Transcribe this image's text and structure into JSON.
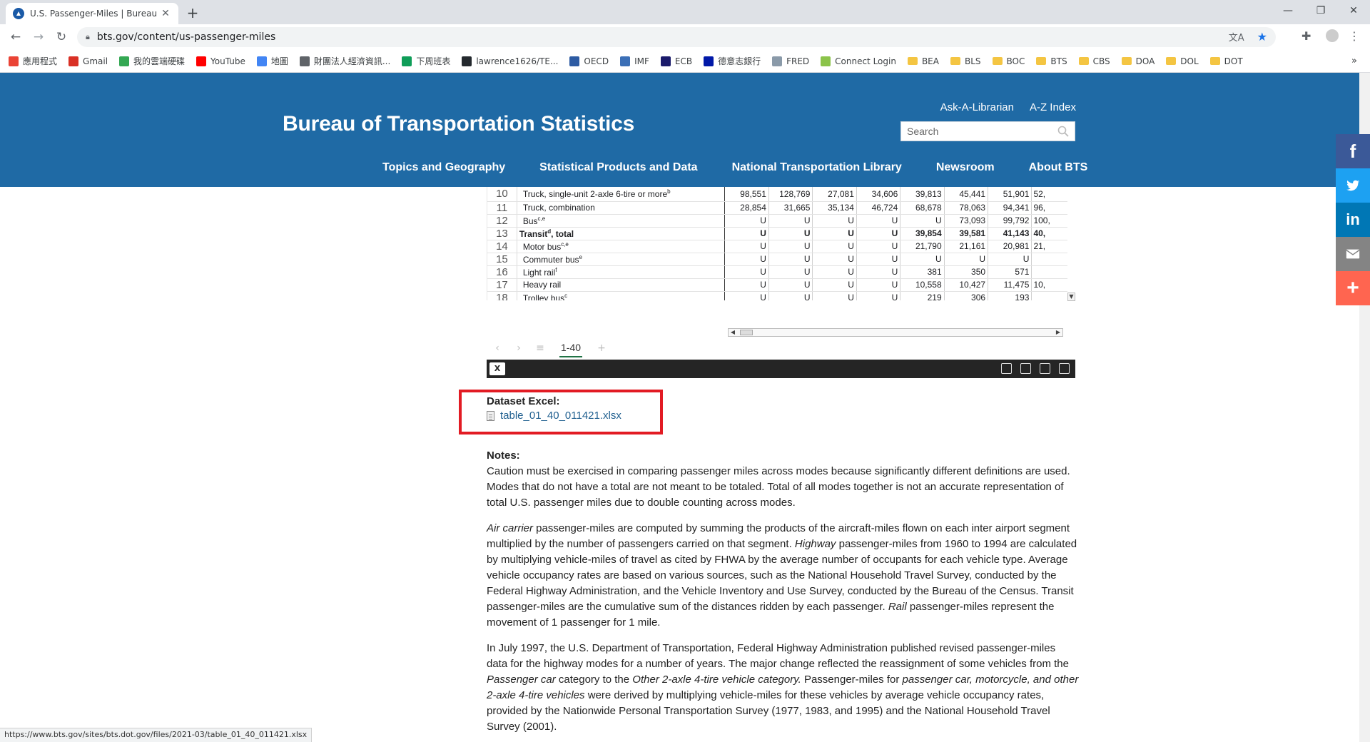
{
  "browser": {
    "tab_title": "U.S. Passenger-Miles | Bureau of",
    "url": "bts.gov/content/us-passenger-miles",
    "status_url": "https://www.bts.gov/sites/bts.dot.gov/files/2021-03/table_01_40_011421.xlsx",
    "bookmarks": [
      {
        "label": "應用程式",
        "icon": "apps-grid-icon",
        "color": "#ea4335",
        "type": "icon"
      },
      {
        "label": "Gmail",
        "icon": "gmail-icon",
        "color": "#d93025",
        "type": "icon"
      },
      {
        "label": "我的雲端硬碟",
        "icon": "drive-icon",
        "color": "#34a853",
        "type": "icon"
      },
      {
        "label": "YouTube",
        "icon": "youtube-icon",
        "color": "#ff0000",
        "type": "icon"
      },
      {
        "label": "地圖",
        "icon": "maps-icon",
        "color": "#4285f4",
        "type": "icon"
      },
      {
        "label": "財團法人經濟資訊...",
        "icon": "globe-icon",
        "color": "#5f6368",
        "type": "icon"
      },
      {
        "label": "下周班表",
        "icon": "sheets-icon",
        "color": "#0f9d58",
        "type": "icon"
      },
      {
        "label": "lawrence1626/TE...",
        "icon": "github-icon",
        "color": "#24292e",
        "type": "icon"
      },
      {
        "label": "OECD",
        "icon": "oecd-icon",
        "color": "#2d5ba3",
        "type": "icon"
      },
      {
        "label": "IMF",
        "icon": "imf-icon",
        "color": "#3b6fb6",
        "type": "icon"
      },
      {
        "label": "ECB",
        "icon": "ecb-icon",
        "color": "#1b1b6b",
        "type": "icon"
      },
      {
        "label": "德意志銀行",
        "icon": "deutsche-bank-icon",
        "color": "#0018a8",
        "type": "icon"
      },
      {
        "label": "FRED",
        "icon": "fred-icon",
        "color": "#8a9aa9",
        "type": "icon"
      },
      {
        "label": "Connect Login",
        "icon": "connect-icon",
        "color": "#8bc34a",
        "type": "icon"
      },
      {
        "label": "BEA",
        "icon": "folder-icon",
        "type": "folder"
      },
      {
        "label": "BLS",
        "icon": "folder-icon",
        "type": "folder"
      },
      {
        "label": "BOC",
        "icon": "folder-icon",
        "type": "folder"
      },
      {
        "label": "BTS",
        "icon": "folder-icon",
        "type": "folder"
      },
      {
        "label": "CBS",
        "icon": "folder-icon",
        "type": "folder"
      },
      {
        "label": "DOA",
        "icon": "folder-icon",
        "type": "folder"
      },
      {
        "label": "DOL",
        "icon": "folder-icon",
        "type": "folder"
      },
      {
        "label": "DOT",
        "icon": "folder-icon",
        "type": "folder"
      }
    ],
    "bookmarks_overflow": "»"
  },
  "site": {
    "title": "Bureau of Transportation Statistics",
    "util_links": [
      "Ask-A-Librarian",
      "A-Z Index"
    ],
    "search_placeholder": "Search",
    "nav": [
      "Topics and Geography",
      "Statistical Products and Data",
      "National Transportation Library",
      "Newsroom",
      "About BTS"
    ],
    "header_color": "#1f6aa5"
  },
  "spreadsheet": {
    "rows": [
      {
        "n": "10",
        "label": "Truck, single-unit 2-axle 6-tire or more",
        "sup": "b",
        "bold": false,
        "values": [
          "98,551",
          "128,769",
          "27,081",
          "34,606",
          "39,813",
          "45,441",
          "51,901",
          "52,"
        ]
      },
      {
        "n": "11",
        "label": "Truck, combination",
        "sup": "",
        "bold": false,
        "values": [
          "28,854",
          "31,665",
          "35,134",
          "46,724",
          "68,678",
          "78,063",
          "94,341",
          "96,"
        ]
      },
      {
        "n": "12",
        "label": "Bus",
        "sup": "c,e",
        "bold": false,
        "values": [
          "U",
          "U",
          "U",
          "U",
          "U",
          "73,093",
          "99,792",
          "100,"
        ]
      },
      {
        "n": "13",
        "label": "Transit",
        "label_suffix": ", total",
        "sup": "d",
        "bold": true,
        "values": [
          "U",
          "U",
          "U",
          "U",
          "39,854",
          "39,581",
          "41,143",
          "40,"
        ]
      },
      {
        "n": "14",
        "label": "Motor bus",
        "sup": "c,e",
        "bold": false,
        "values": [
          "U",
          "U",
          "U",
          "U",
          "21,790",
          "21,161",
          "20,981",
          "21,"
        ]
      },
      {
        "n": "15",
        "label": "Commuter bus",
        "sup": "e",
        "bold": false,
        "values": [
          "U",
          "U",
          "U",
          "U",
          "U",
          "U",
          "U",
          ""
        ]
      },
      {
        "n": "16",
        "label": "Light rail",
        "sup": "f",
        "bold": false,
        "values": [
          "U",
          "U",
          "U",
          "U",
          "381",
          "350",
          "571",
          ""
        ]
      },
      {
        "n": "17",
        "label": "Heavy rail",
        "sup": "",
        "bold": false,
        "values": [
          "U",
          "U",
          "U",
          "U",
          "10,558",
          "10,427",
          "11,475",
          "10,"
        ]
      },
      {
        "n": "18",
        "label": "Trolley bus",
        "sup": "c",
        "bold": false,
        "values": [
          "U",
          "U",
          "U",
          "U",
          "219",
          "306",
          "193",
          ""
        ]
      }
    ],
    "sheet_tab": "1-40",
    "add_sheet": "+"
  },
  "dataset": {
    "title": "Dataset Excel:",
    "file": "table_01_40_011421.xlsx",
    "highlight_color": "#e21b23"
  },
  "notes": {
    "title": "Notes:",
    "p1": "Caution must be exercised in comparing passenger miles across modes because significantly different definitions are used. Modes that do not have a total are not meant to be totaled. Total of all modes together is not an accurate representation of total U.S. passenger miles due to double counting across modes.",
    "p2": [
      {
        "t": "Air carrier",
        "i": true
      },
      {
        "t": " passenger-miles are computed by summing the products of the aircraft-miles flown on each inter airport segment multiplied by the number of passengers carried on that segment. ",
        "i": false
      },
      {
        "t": "Highway",
        "i": true
      },
      {
        "t": " passenger-miles from 1960 to 1994 are calculated by multiplying vehicle-miles of travel as cited by FHWA by the average number of occupants for each vehicle type. Average vehicle occupancy rates are based on various sources, such as the National Household Travel Survey, conducted by the Federal Highway Administration, and the Vehicle Inventory and Use Survey, conducted by the Bureau of the Census. Transit passenger-miles are the cumulative sum of the distances ridden by each passenger. ",
        "i": false
      },
      {
        "t": "Rail",
        "i": true
      },
      {
        "t": " passenger-miles represent the movement of 1 passenger for 1 mile.",
        "i": false
      }
    ],
    "p3": [
      {
        "t": "In July 1997, the U.S. Department of Transportation, Federal Highway Administration published revised passenger-miles data for the highway modes for a number of years. The major change reflected the reassignment of some vehicles from the ",
        "i": false
      },
      {
        "t": "Passenger car",
        "i": true
      },
      {
        "t": " category to the ",
        "i": false
      },
      {
        "t": "Other 2-axle 4-tire vehicle category.",
        "i": true
      },
      {
        "t": " Passenger-miles for ",
        "i": false
      },
      {
        "t": "passenger car, motorcycle, and other 2-axle 4-tire vehicles",
        "i": true
      },
      {
        "t": " were derived by multiplying vehicle-miles for these vehicles by average vehicle occupancy rates, provided by the Nationwide Personal Transportation Survey (1977, 1983, and 1995) and the National Household Travel Survey (2001).",
        "i": false
      }
    ]
  },
  "share": [
    {
      "name": "facebook-share-button",
      "icon": "f",
      "color": "#3b5998"
    },
    {
      "name": "twitter-share-button",
      "icon": "twitter",
      "color": "#1da1f2"
    },
    {
      "name": "linkedin-share-button",
      "icon": "in",
      "color": "#0077b5"
    },
    {
      "name": "email-share-button",
      "icon": "mail",
      "color": "#848484"
    },
    {
      "name": "more-share-button",
      "icon": "+",
      "color": "#ff6550"
    }
  ]
}
